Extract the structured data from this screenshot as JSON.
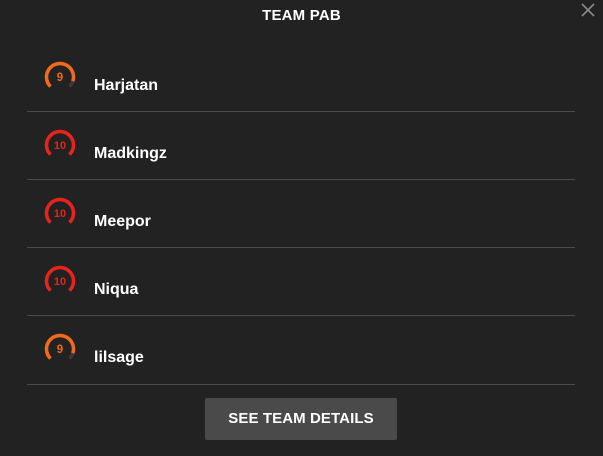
{
  "dialog": {
    "title": "TEAM PAB",
    "close_icon": "close-icon"
  },
  "players": [
    {
      "name": "Harjatan",
      "level": "9",
      "level_value": 9,
      "color": "#f26a1b",
      "icon": "level-gauge-icon"
    },
    {
      "name": "Madkingz",
      "level": "10",
      "level_value": 10,
      "color": "#e8231c",
      "icon": "level-gauge-icon"
    },
    {
      "name": "Meepor",
      "level": "10",
      "level_value": 10,
      "color": "#e8231c",
      "icon": "level-gauge-icon"
    },
    {
      "name": "Niqua",
      "level": "10",
      "level_value": 10,
      "color": "#e8231c",
      "icon": "level-gauge-icon"
    },
    {
      "name": "lilsage",
      "level": "9",
      "level_value": 9,
      "color": "#f26a1b",
      "icon": "level-gauge-icon"
    }
  ],
  "footer": {
    "details_label": "SEE TEAM DETAILS"
  },
  "colors": {
    "background": "#222222",
    "divider": "#4a4a4a",
    "button": "#4a4a4a",
    "gauge_track": "#3a3a3a"
  }
}
